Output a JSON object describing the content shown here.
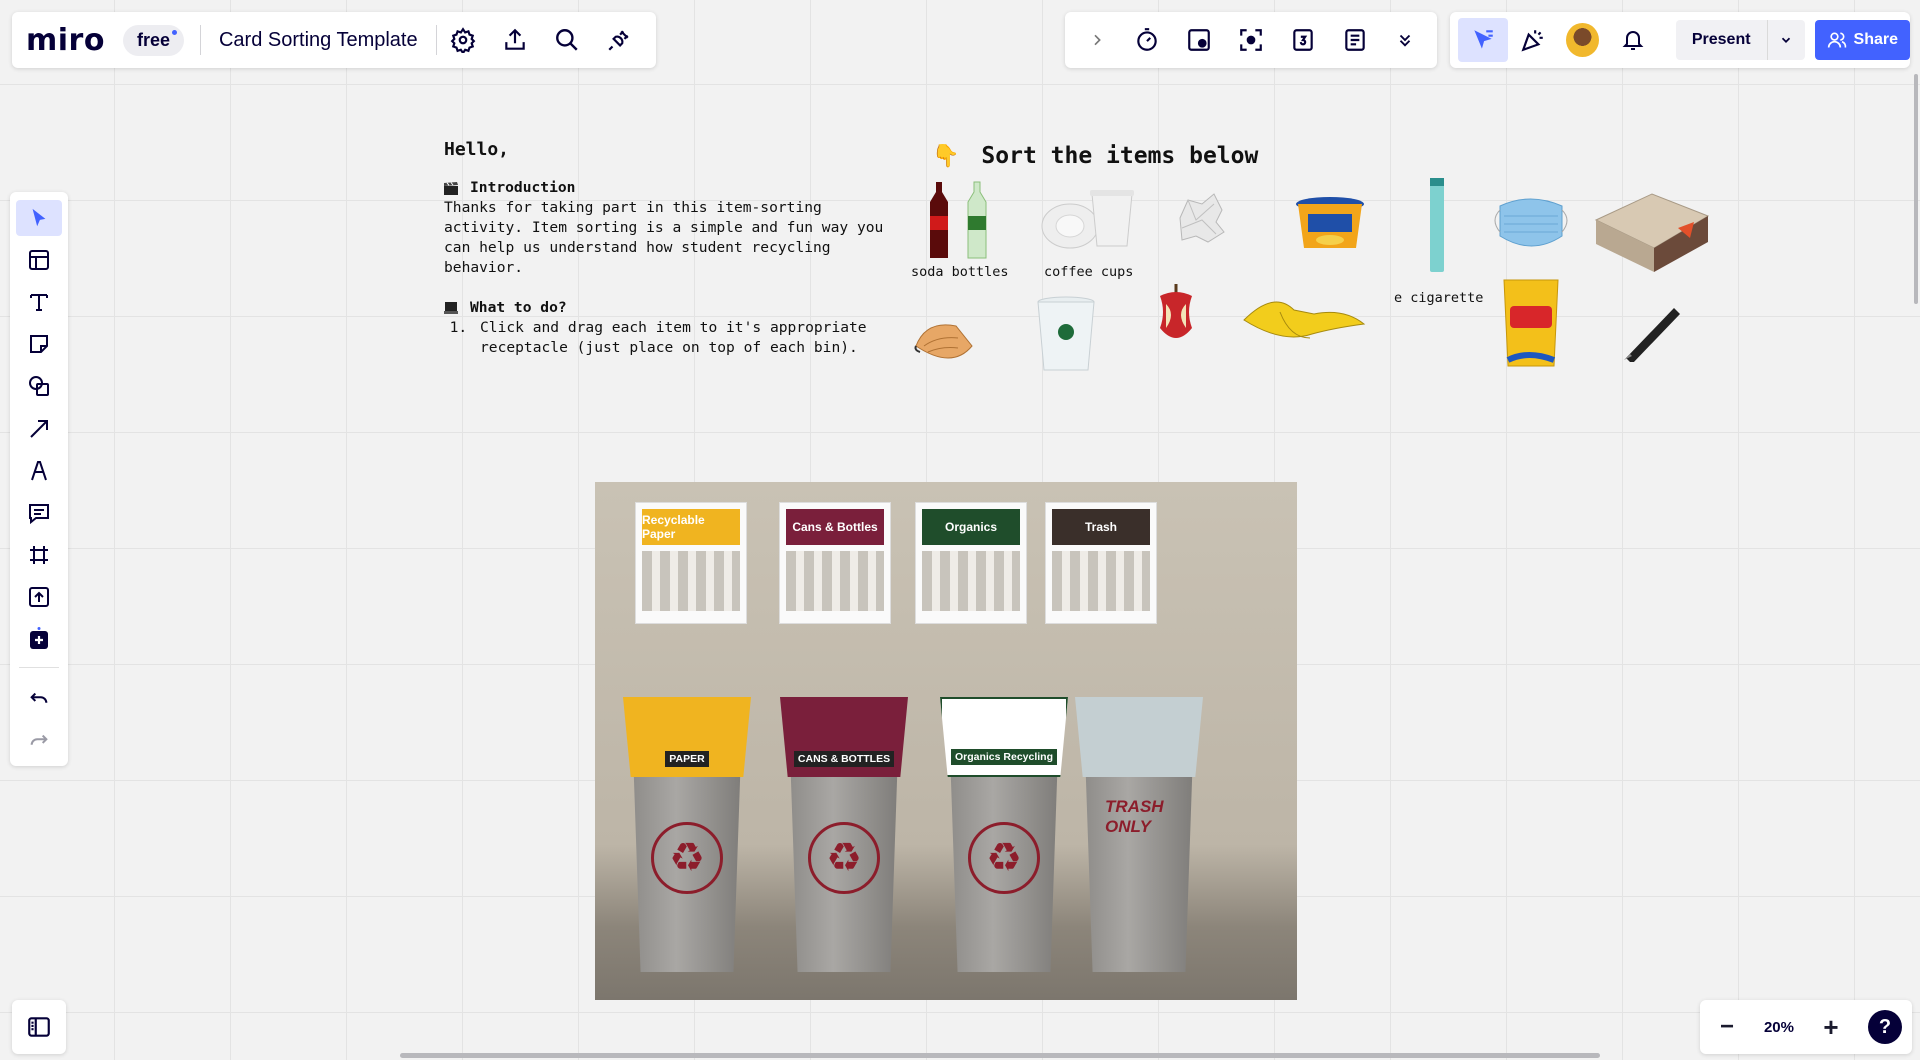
{
  "app": {
    "logo": "miro",
    "plan": "free"
  },
  "board": {
    "title": "Card Sorting Template"
  },
  "top_tools": {
    "icons": [
      "chevron-right-icon",
      "timer-icon",
      "sticky-board-icon",
      "focus-icon",
      "calendar-icon",
      "notes-icon",
      "more-icon"
    ]
  },
  "collab": {
    "present_label": "Present",
    "share_label": "Share"
  },
  "left_tools": [
    "select",
    "templates",
    "text",
    "sticky-note",
    "shapes",
    "arrow",
    "pen",
    "comment",
    "frame",
    "upload",
    "add-more",
    "undo",
    "redo"
  ],
  "zoom": {
    "level": "20%",
    "minus": "−",
    "plus": "+",
    "help": "?"
  },
  "intro": {
    "greeting": "Hello,",
    "intro_heading": "Introduction",
    "intro_text": "Thanks for taking part in this item-sorting activity. Item sorting is a simple and fun way you can help us understand how student recycling behavior.",
    "todo_heading": "What to do?",
    "todo_items": [
      "Click and drag each item to it's appropriate receptacle (just place on top of each bin)."
    ]
  },
  "sort": {
    "heading": "Sort the items below",
    "hand_emoji": "👇",
    "labels": {
      "soda": "soda bottles",
      "coffee": "coffee cups",
      "ecig": "e cigarette"
    }
  },
  "photo": {
    "signs": [
      "Recyclable Paper",
      "Cans & Bottles",
      "Organics",
      "Trash"
    ],
    "bins": [
      "PAPER",
      "CANS & BOTTLES",
      "Organics Recycling",
      "TRASH ONLY"
    ],
    "colors": {
      "paper": "#f0b420",
      "cans": "#7a1f3b",
      "organics": "#1f4d2b",
      "trash": "#3a2f2a",
      "brand": "#4262ff"
    }
  }
}
